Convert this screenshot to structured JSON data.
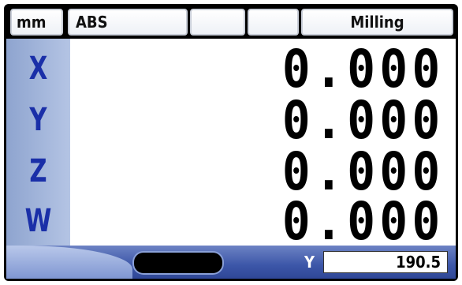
{
  "status_bar": {
    "unit": "mm",
    "mode": "ABS",
    "slot3": "",
    "slot4": "",
    "app_mode": "Milling"
  },
  "axes": [
    {
      "label": "X",
      "value": "0.000"
    },
    {
      "label": "Y",
      "value": "0.000"
    },
    {
      "label": "Z",
      "value": "0.000"
    },
    {
      "label": "W",
      "value": "0.000"
    }
  ],
  "bottom_bar": {
    "aux_axis_label": "Y",
    "aux_axis_value": "190.5"
  },
  "colors": {
    "axis_label": "#1a2fa8",
    "axis_panel": "#a6b8e0",
    "bottom_bar": "#3c56a8"
  }
}
